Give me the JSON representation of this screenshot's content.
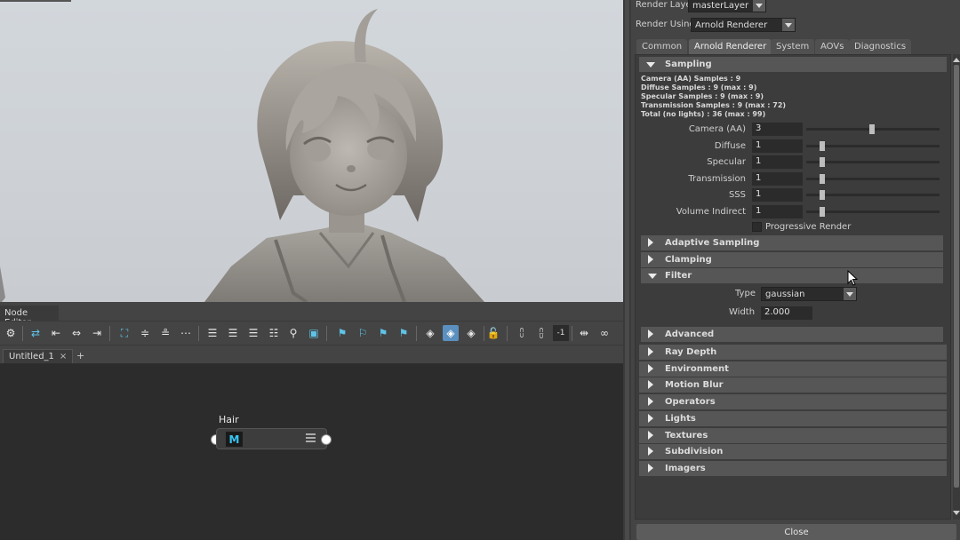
{
  "viewport": {
    "model_description_icon": "character-figure"
  },
  "node_editor": {
    "title": "Node Editor",
    "toolbar": {
      "frame_field_value": "-1"
    },
    "tab": {
      "label": "Untitled_1",
      "close": "×",
      "add": "+"
    },
    "node": {
      "label": "Hair",
      "icon_text": "M"
    }
  },
  "render_settings": {
    "render_layer_label": "Render Layer",
    "render_layer_value": "masterLayer",
    "render_using_label": "Render Using",
    "render_using_value": "Arnold Renderer",
    "tabs": [
      "Common",
      "Arnold Renderer",
      "System",
      "AOVs",
      "Diagnostics"
    ],
    "active_tab": "Arnold Renderer",
    "sampling": {
      "title": "Sampling",
      "info": [
        "Camera (AA) Samples : 9",
        "Diffuse Samples : 9 (max : 9)",
        "Specular Samples : 9 (max : 9)",
        "Transmission Samples : 9 (max : 72)",
        "Total (no lights) : 36 (max : 99)"
      ],
      "attrs": [
        {
          "label": "Camera (AA)",
          "value": "3",
          "slider": 0.47
        },
        {
          "label": "Diffuse",
          "value": "1",
          "slider": 0.1
        },
        {
          "label": "Specular",
          "value": "1",
          "slider": 0.1
        },
        {
          "label": "Transmission",
          "value": "1",
          "slider": 0.1
        },
        {
          "label": "SSS",
          "value": "1",
          "slider": 0.1
        },
        {
          "label": "Volume Indirect",
          "value": "1",
          "slider": 0.1
        }
      ],
      "progressive_label": "Progressive Render"
    },
    "sub_sections": [
      "Adaptive Sampling",
      "Clamping"
    ],
    "filter": {
      "title": "Filter",
      "type_label": "Type",
      "type_value": "gaussian",
      "width_label": "Width",
      "width_value": "2.000"
    },
    "advanced": "Advanced",
    "sections": [
      "Ray Depth",
      "Environment",
      "Motion Blur",
      "Operators",
      "Lights",
      "Textures",
      "Subdivision",
      "Imagers"
    ],
    "close_label": "Close"
  },
  "colors": {
    "accent_blue": "#5ec3e6",
    "panel_bg": "#444444",
    "field_bg": "#2b2b2b",
    "header_bg": "#565656"
  }
}
